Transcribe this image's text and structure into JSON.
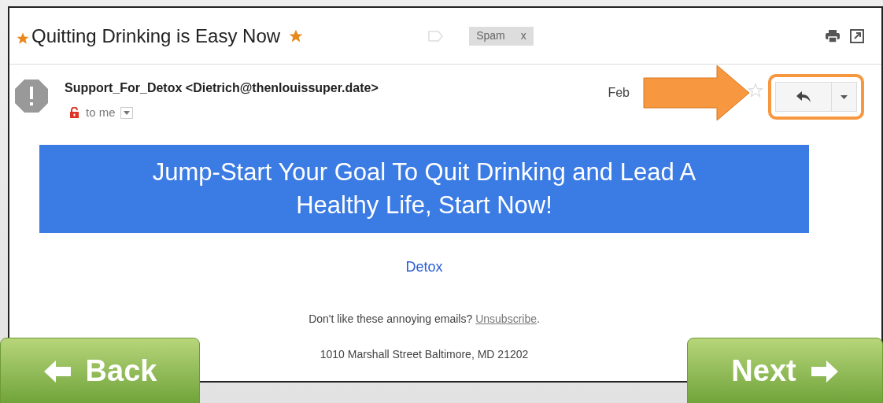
{
  "email": {
    "subject": "Quitting Drinking is Easy Now",
    "important": true,
    "starred": true,
    "labels": [
      {
        "text": "Spam",
        "remove": "x"
      }
    ],
    "sender": "Support_For_Detox <Dietrich@thenlouissuper.date>",
    "recipient": "to me",
    "date": "Feb",
    "message_starred": false,
    "banner": "Jump-Start Your Goal To Quit Drinking and Lead A Healthy Life, Start Now!",
    "link": "Detox",
    "footer_text": "Don't like these annoying emails? ",
    "unsubscribe": "Unsubscribe",
    "footer_end": ".",
    "address": "1010 Marshall Street Baltimore, MD 21202"
  },
  "navigation": [
    {
      "kind": "back",
      "label": "Back"
    },
    {
      "kind": "next",
      "label": "Next"
    }
  ]
}
